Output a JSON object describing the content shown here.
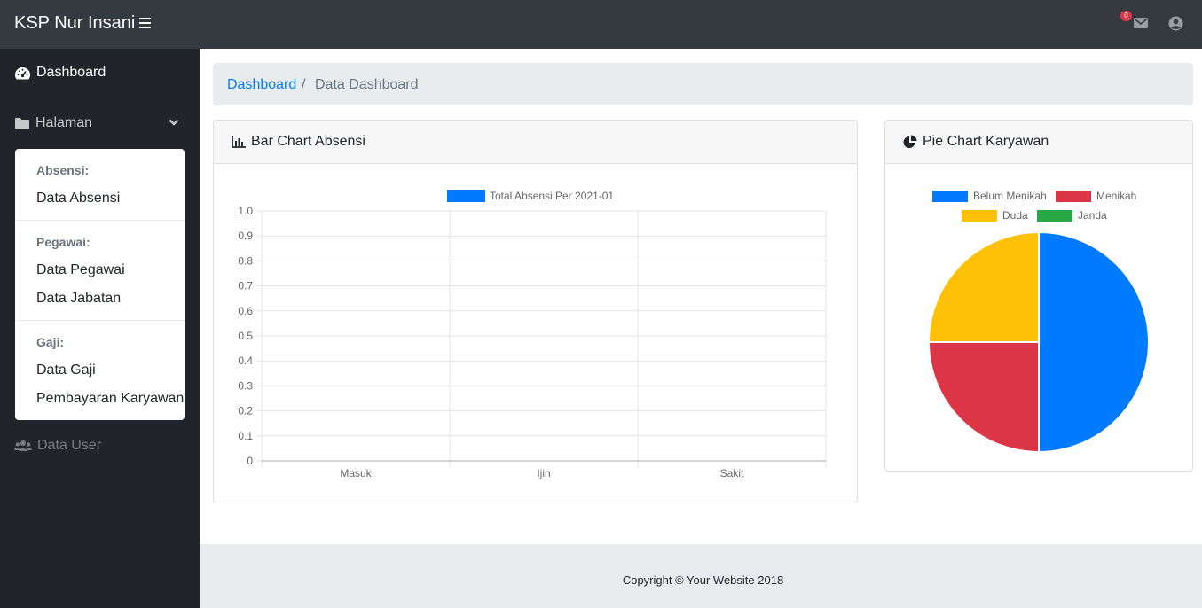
{
  "navbar": {
    "brand": "KSP Nur Insani",
    "menu_icon": "bars-icon",
    "mail_icon": "envelope-icon",
    "mail_badge": "0",
    "user_icon": "user-circle-icon"
  },
  "sidebar": {
    "dashboard": {
      "label": "Dashboard",
      "icon": "tachometer-icon"
    },
    "halaman": {
      "label": "Halaman",
      "icon": "folder-icon"
    },
    "dropdown": {
      "sections": [
        {
          "header": "Absensi:",
          "items": [
            "Data Absensi"
          ]
        },
        {
          "header": "Pegawai:",
          "items": [
            "Data Pegawai",
            "Data Jabatan"
          ]
        },
        {
          "header": "Gaji:",
          "items": [
            "Data Gaji",
            "Pembayaran Karyawan"
          ]
        }
      ]
    },
    "data_user": {
      "label": "Data User",
      "icon": "users-icon"
    }
  },
  "breadcrumb": {
    "link": "Dashboard",
    "separator": "/",
    "active": "Data Dashboard"
  },
  "bar_card": {
    "title": "Bar Chart Absensi",
    "icon": "chart-bar-icon"
  },
  "pie_card": {
    "title": "Pie Chart Karyawan",
    "icon": "chart-pie-icon"
  },
  "footer": {
    "text": "Copyright © Your Website 2018"
  },
  "chart_data": [
    {
      "type": "bar",
      "categories": [
        "Masuk",
        "Ijin",
        "Sakit"
      ],
      "series": [
        {
          "name": "Total Absensi Per 2021-01",
          "values": [
            0,
            0,
            0
          ],
          "color": "#007bff"
        }
      ],
      "ylim": [
        0,
        1.0
      ],
      "yticks": [
        "1.0",
        "0.9",
        "0.8",
        "0.7",
        "0.6",
        "0.5",
        "0.4",
        "0.3",
        "0.2",
        "0.1",
        "0"
      ],
      "grid": true,
      "legend": "top"
    },
    {
      "type": "pie",
      "labels": [
        "Belum Menikah",
        "Menikah",
        "Duda",
        "Janda"
      ],
      "values": [
        2,
        1,
        1,
        0
      ],
      "colors": [
        "#007bff",
        "#dc3545",
        "#ffc107",
        "#28a745"
      ],
      "legend": "top"
    }
  ]
}
